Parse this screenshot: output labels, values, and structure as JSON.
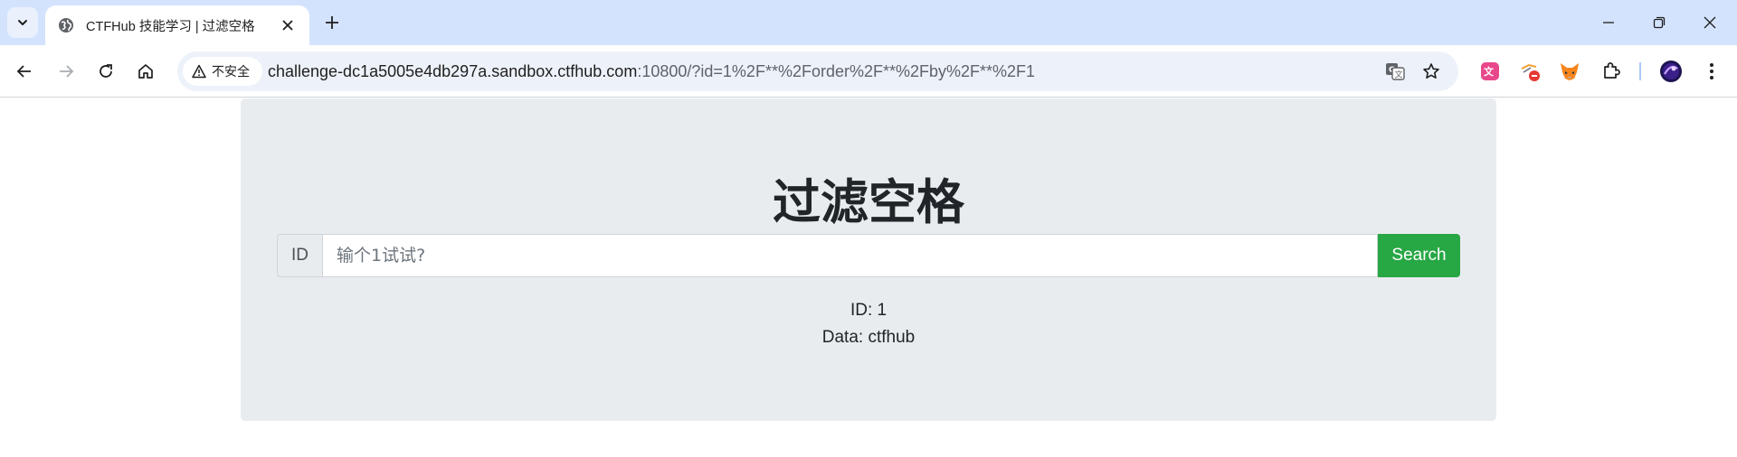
{
  "browser": {
    "tab": {
      "title": "CTFHub 技能学习 | 过滤空格"
    },
    "omnibox": {
      "security_label": "不安全",
      "url_host": "challenge-dc1a5005e4db297a.sandbox.ctfhub.com",
      "url_rest": ":10800/?id=1%2F**%2Forder%2F**%2Fby%2F**%2F1"
    }
  },
  "page": {
    "heading": "过滤空格",
    "addon_label": "ID",
    "input_placeholder": "输个1试试?",
    "search_label": "Search",
    "result_id": "ID: 1",
    "result_data": "Data: ctfhub"
  },
  "colors": {
    "tabstrip": "#d3e3fd",
    "search_button": "#28a745",
    "panel": "#e9ecef"
  }
}
